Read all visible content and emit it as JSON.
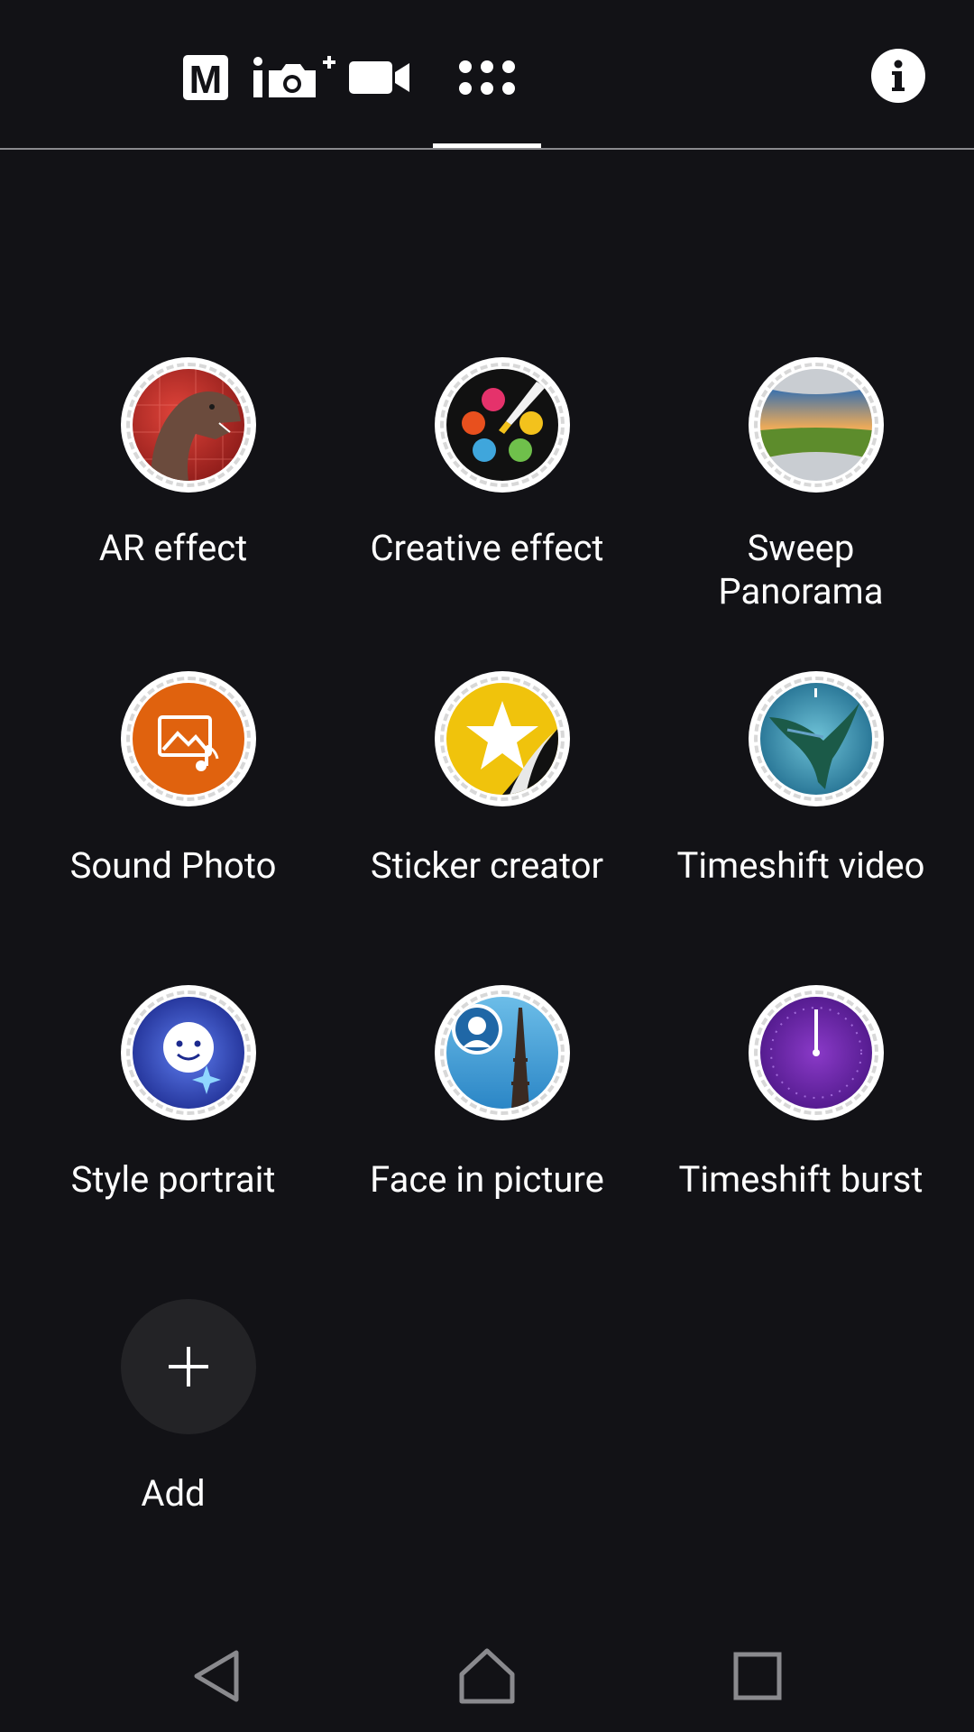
{
  "top_modes": {
    "manual_label": "M",
    "manual_icon": "manual-mode-icon",
    "photo_icon": "superior-auto-camera-icon",
    "video_icon": "video-camera-icon",
    "apps_icon": "apps-grid-icon",
    "info_icon": "info-icon"
  },
  "apps": [
    {
      "label": "AR effect",
      "icon": "ar-effect-icon"
    },
    {
      "label": "Creative effect",
      "icon": "creative-effect-icon"
    },
    {
      "label": "Sweep Panorama",
      "icon": "sweep-panorama-icon"
    },
    {
      "label": "Sound Photo",
      "icon": "sound-photo-icon"
    },
    {
      "label": "Sticker creator",
      "icon": "sticker-creator-icon"
    },
    {
      "label": "Timeshift video",
      "icon": "timeshift-video-icon"
    },
    {
      "label": "Style portrait",
      "icon": "style-portrait-icon"
    },
    {
      "label": "Face in picture",
      "icon": "face-in-picture-icon"
    },
    {
      "label": "Timeshift burst",
      "icon": "timeshift-burst-icon"
    }
  ],
  "add": {
    "label": "Add",
    "icon": "plus-icon"
  },
  "nav": {
    "back_icon": "back-icon",
    "home_icon": "home-icon",
    "recents_icon": "recents-icon"
  },
  "colors": {
    "background": "#121216",
    "text": "#ffffff",
    "divider": "#8a8a8e"
  }
}
